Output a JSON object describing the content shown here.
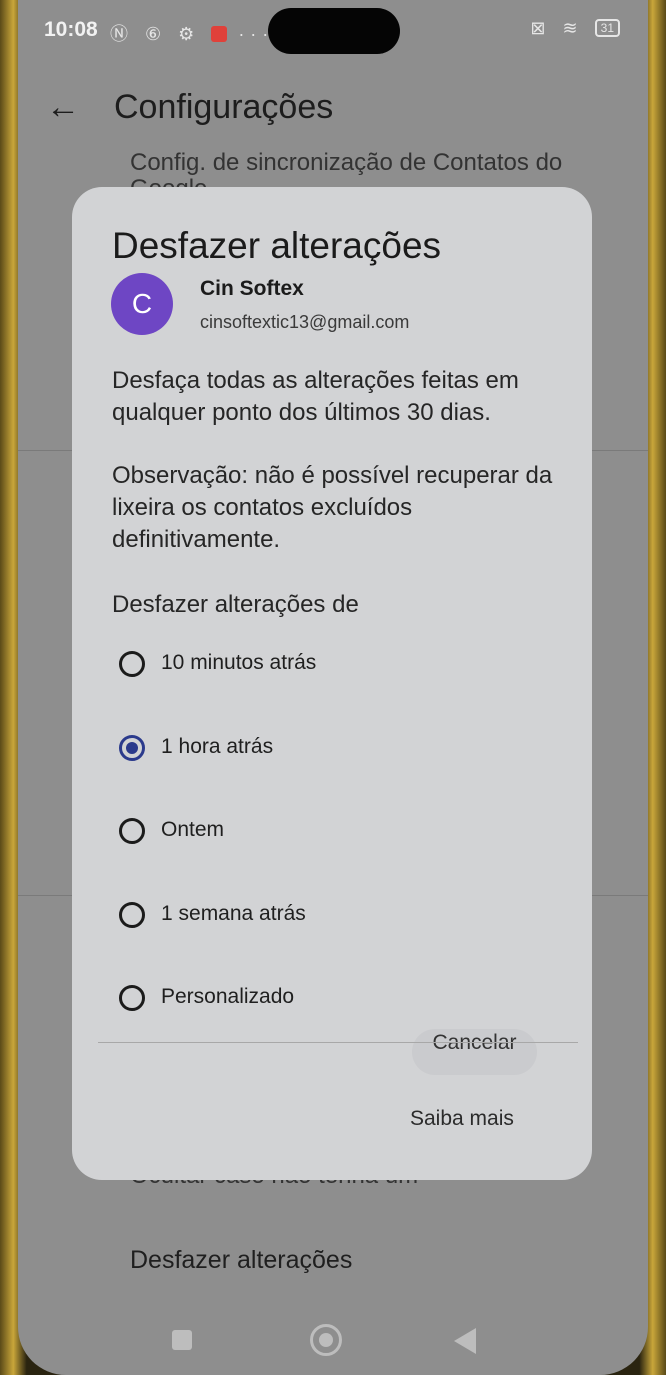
{
  "status_bar": {
    "time": "10:08",
    "icons_left": "Ⓝ ⑥ ⚙",
    "more": "···",
    "battery": "31"
  },
  "app_bar": {
    "title": "Configurações"
  },
  "background": {
    "top_text": "Config. de sincronização de Contatos do Google",
    "hide_text": "Ocultar caso não tenha um",
    "undo_changes": "Desfazer alterações"
  },
  "dialog": {
    "title": "Desfazer alterações",
    "account": {
      "initial": "C",
      "name": "Cin Softex",
      "email": "cinsoftextic13@gmail.com",
      "avatar_color": "#6e46c4"
    },
    "description": "Desfaça todas as alterações feitas em qualquer ponto dos últimos 30 dias.",
    "note": "Observação: não é possível recuperar da lixeira os contatos excluídos definitivamente.",
    "radio_heading": "Desfazer alterações de",
    "options": [
      {
        "label": "10 minutos atrás",
        "selected": false
      },
      {
        "label": "1 hora atrás",
        "selected": true
      },
      {
        "label": "Ontem",
        "selected": false
      },
      {
        "label": "1 semana atrás",
        "selected": false
      },
      {
        "label": "Personalizado",
        "selected": false
      }
    ],
    "cancel_label": "Cancelar",
    "learn_more_label": "Saiba mais"
  },
  "colors": {
    "accent": "#2b3a8c",
    "dialog_bg": "#d2d3d5"
  }
}
